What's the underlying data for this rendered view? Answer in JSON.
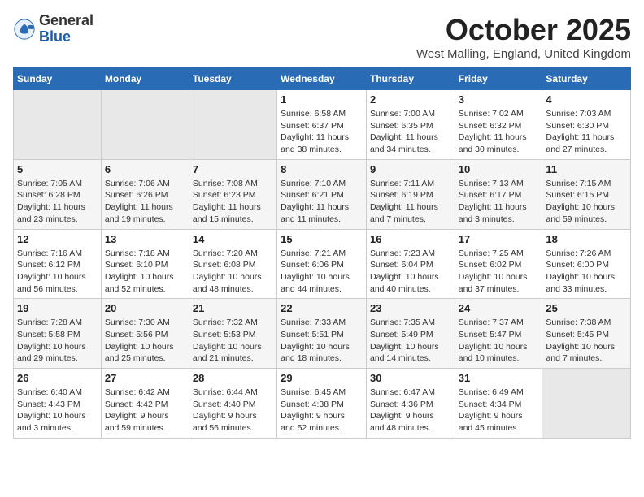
{
  "logo": {
    "general": "General",
    "blue": "Blue"
  },
  "title": "October 2025",
  "location": "West Malling, England, United Kingdom",
  "days_of_week": [
    "Sunday",
    "Monday",
    "Tuesday",
    "Wednesday",
    "Thursday",
    "Friday",
    "Saturday"
  ],
  "weeks": [
    [
      {
        "day": "",
        "info": ""
      },
      {
        "day": "",
        "info": ""
      },
      {
        "day": "",
        "info": ""
      },
      {
        "day": "1",
        "info": "Sunrise: 6:58 AM\nSunset: 6:37 PM\nDaylight: 11 hours\nand 38 minutes."
      },
      {
        "day": "2",
        "info": "Sunrise: 7:00 AM\nSunset: 6:35 PM\nDaylight: 11 hours\nand 34 minutes."
      },
      {
        "day": "3",
        "info": "Sunrise: 7:02 AM\nSunset: 6:32 PM\nDaylight: 11 hours\nand 30 minutes."
      },
      {
        "day": "4",
        "info": "Sunrise: 7:03 AM\nSunset: 6:30 PM\nDaylight: 11 hours\nand 27 minutes."
      }
    ],
    [
      {
        "day": "5",
        "info": "Sunrise: 7:05 AM\nSunset: 6:28 PM\nDaylight: 11 hours\nand 23 minutes."
      },
      {
        "day": "6",
        "info": "Sunrise: 7:06 AM\nSunset: 6:26 PM\nDaylight: 11 hours\nand 19 minutes."
      },
      {
        "day": "7",
        "info": "Sunrise: 7:08 AM\nSunset: 6:23 PM\nDaylight: 11 hours\nand 15 minutes."
      },
      {
        "day": "8",
        "info": "Sunrise: 7:10 AM\nSunset: 6:21 PM\nDaylight: 11 hours\nand 11 minutes."
      },
      {
        "day": "9",
        "info": "Sunrise: 7:11 AM\nSunset: 6:19 PM\nDaylight: 11 hours\nand 7 minutes."
      },
      {
        "day": "10",
        "info": "Sunrise: 7:13 AM\nSunset: 6:17 PM\nDaylight: 11 hours\nand 3 minutes."
      },
      {
        "day": "11",
        "info": "Sunrise: 7:15 AM\nSunset: 6:15 PM\nDaylight: 10 hours\nand 59 minutes."
      }
    ],
    [
      {
        "day": "12",
        "info": "Sunrise: 7:16 AM\nSunset: 6:12 PM\nDaylight: 10 hours\nand 56 minutes."
      },
      {
        "day": "13",
        "info": "Sunrise: 7:18 AM\nSunset: 6:10 PM\nDaylight: 10 hours\nand 52 minutes."
      },
      {
        "day": "14",
        "info": "Sunrise: 7:20 AM\nSunset: 6:08 PM\nDaylight: 10 hours\nand 48 minutes."
      },
      {
        "day": "15",
        "info": "Sunrise: 7:21 AM\nSunset: 6:06 PM\nDaylight: 10 hours\nand 44 minutes."
      },
      {
        "day": "16",
        "info": "Sunrise: 7:23 AM\nSunset: 6:04 PM\nDaylight: 10 hours\nand 40 minutes."
      },
      {
        "day": "17",
        "info": "Sunrise: 7:25 AM\nSunset: 6:02 PM\nDaylight: 10 hours\nand 37 minutes."
      },
      {
        "day": "18",
        "info": "Sunrise: 7:26 AM\nSunset: 6:00 PM\nDaylight: 10 hours\nand 33 minutes."
      }
    ],
    [
      {
        "day": "19",
        "info": "Sunrise: 7:28 AM\nSunset: 5:58 PM\nDaylight: 10 hours\nand 29 minutes."
      },
      {
        "day": "20",
        "info": "Sunrise: 7:30 AM\nSunset: 5:56 PM\nDaylight: 10 hours\nand 25 minutes."
      },
      {
        "day": "21",
        "info": "Sunrise: 7:32 AM\nSunset: 5:53 PM\nDaylight: 10 hours\nand 21 minutes."
      },
      {
        "day": "22",
        "info": "Sunrise: 7:33 AM\nSunset: 5:51 PM\nDaylight: 10 hours\nand 18 minutes."
      },
      {
        "day": "23",
        "info": "Sunrise: 7:35 AM\nSunset: 5:49 PM\nDaylight: 10 hours\nand 14 minutes."
      },
      {
        "day": "24",
        "info": "Sunrise: 7:37 AM\nSunset: 5:47 PM\nDaylight: 10 hours\nand 10 minutes."
      },
      {
        "day": "25",
        "info": "Sunrise: 7:38 AM\nSunset: 5:45 PM\nDaylight: 10 hours\nand 7 minutes."
      }
    ],
    [
      {
        "day": "26",
        "info": "Sunrise: 6:40 AM\nSunset: 4:43 PM\nDaylight: 10 hours\nand 3 minutes."
      },
      {
        "day": "27",
        "info": "Sunrise: 6:42 AM\nSunset: 4:42 PM\nDaylight: 9 hours\nand 59 minutes."
      },
      {
        "day": "28",
        "info": "Sunrise: 6:44 AM\nSunset: 4:40 PM\nDaylight: 9 hours\nand 56 minutes."
      },
      {
        "day": "29",
        "info": "Sunrise: 6:45 AM\nSunset: 4:38 PM\nDaylight: 9 hours\nand 52 minutes."
      },
      {
        "day": "30",
        "info": "Sunrise: 6:47 AM\nSunset: 4:36 PM\nDaylight: 9 hours\nand 48 minutes."
      },
      {
        "day": "31",
        "info": "Sunrise: 6:49 AM\nSunset: 4:34 PM\nDaylight: 9 hours\nand 45 minutes."
      },
      {
        "day": "",
        "info": ""
      }
    ]
  ]
}
